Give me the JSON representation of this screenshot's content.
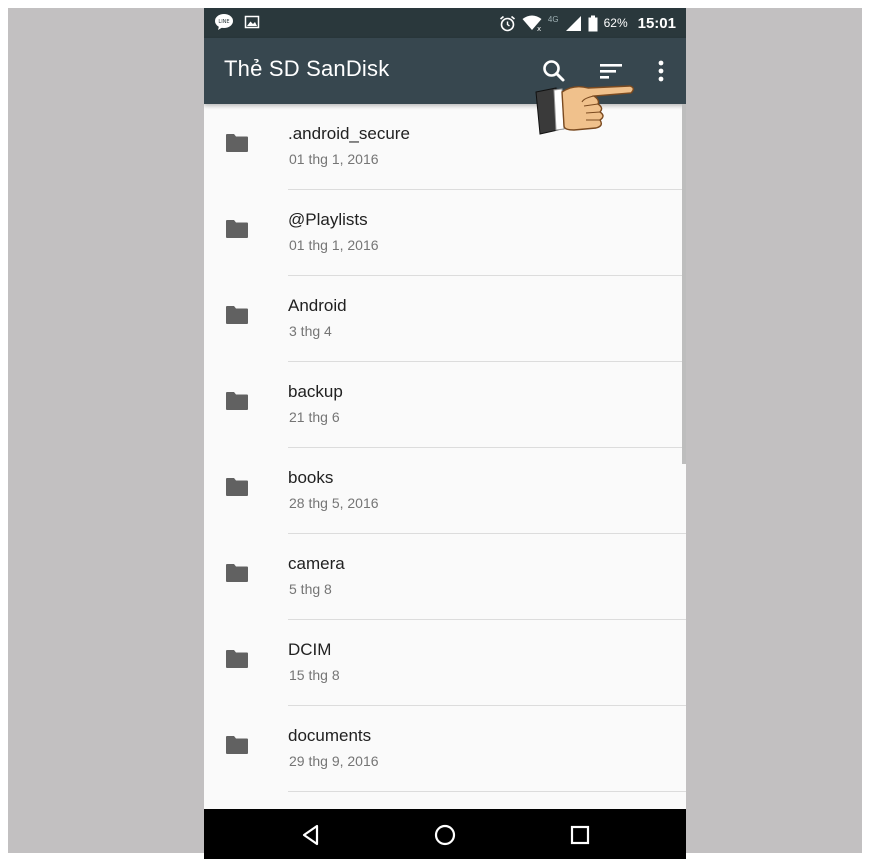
{
  "status_bar": {
    "network": "4G",
    "battery_percent": "62%",
    "time": "15:01"
  },
  "app_bar": {
    "title": "Thẻ SD SanDisk",
    "actions": [
      "search-icon",
      "sort-icon",
      "more-vert-icon"
    ]
  },
  "files": [
    {
      "name": ".android_secure",
      "date": "01 thg 1, 2016"
    },
    {
      "name": "@Playlists",
      "date": "01 thg 1, 2016"
    },
    {
      "name": "Android",
      "date": "3 thg 4"
    },
    {
      "name": "backup",
      "date": "21 thg 6"
    },
    {
      "name": "books",
      "date": "28 thg 5, 2016"
    },
    {
      "name": "camera",
      "date": "5 thg 8"
    },
    {
      "name": "DCIM",
      "date": "15 thg 8"
    },
    {
      "name": "documents",
      "date": "29 thg 9, 2016"
    }
  ],
  "nav_bar": [
    "back-icon",
    "home-icon",
    "recents-icon"
  ],
  "colors": {
    "status_bar": "#2a383c",
    "app_bar": "#37474f",
    "list_background": "#fafafa",
    "folder_icon": "#616161",
    "backdrop": "#c2c0c1"
  }
}
